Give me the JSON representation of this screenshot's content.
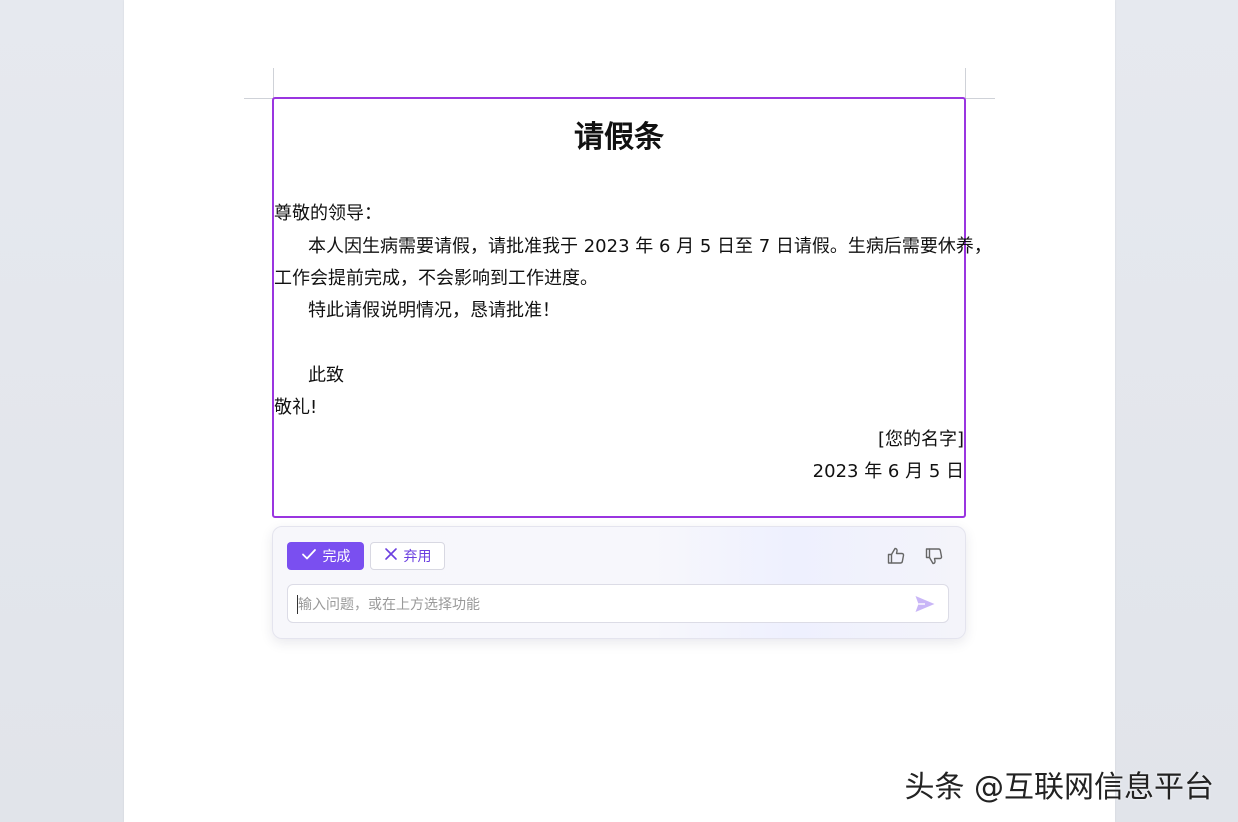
{
  "document": {
    "title": "请假条",
    "greeting": "尊敬的领导：",
    "paragraph1_line1": "本人因生病需要请假，请批准我于 2023 年 6 月 5 日至 7 日请假。生病后需要休养，",
    "paragraph1_line2": "工作会提前完成，不会影响到工作进度。",
    "paragraph2": "特此请假说明情况，恳请批准！",
    "closing_cizhi": "此致",
    "closing_jingli": "敬礼!",
    "signature_name": "[您的名字]",
    "signature_date": "2023 年 6 月 5 日"
  },
  "ai_panel": {
    "done_label": "完成",
    "discard_label": "弃用",
    "input_placeholder": "输入问题，或在上方选择功能",
    "input_value": "",
    "accent_color": "#7a4ff0",
    "border_color": "#9a35e0"
  },
  "icons": {
    "done": "check-icon",
    "discard": "close-icon",
    "like": "thumb-up-icon",
    "dislike": "thumb-down-icon",
    "send": "send-icon"
  },
  "watermark": "头条 @互联网信息平台"
}
